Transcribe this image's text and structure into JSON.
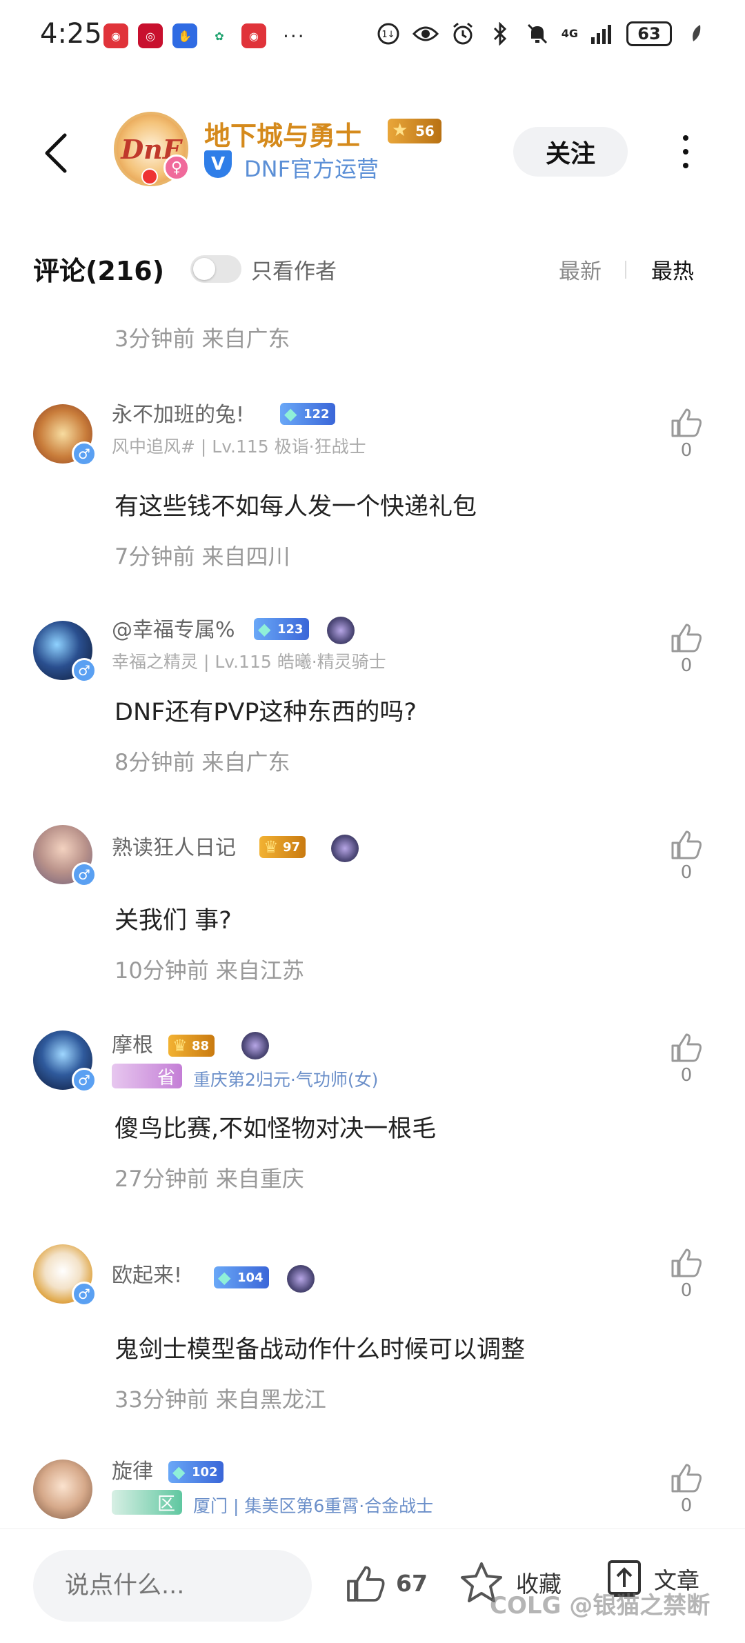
{
  "status_bar": {
    "time": "4:25",
    "network": "4G",
    "battery": "63",
    "dots": "···"
  },
  "header": {
    "channel_name": "地下城与勇士",
    "level": "56",
    "verified_mark": "V",
    "subtitle": "DNF官方运营",
    "follow_label": "关注",
    "avatar_logo": "DnF"
  },
  "comments_header": {
    "title": "评论(216)",
    "author_only_label": "只看作者",
    "sort_newest": "最新",
    "sort_hottest": "最热"
  },
  "top_meta": "3分钟前   来自广东",
  "comments": [
    {
      "name": "永不加班的兔!",
      "badge": "122",
      "sub": "风中追风# | Lv.115 极诣·狂战士",
      "text": "有这些钱不如每人发一个快递礼包",
      "meta": "7分钟前   来自四川",
      "likes": "0"
    },
    {
      "name": "@幸福专属%",
      "badge": "123",
      "sub": "幸福之精灵 | Lv.115 皓曦·精灵骑士",
      "text": "DNF还有PVP这种东西的吗?",
      "meta": "8分钟前   来自广东",
      "likes": "0"
    },
    {
      "name": "熟读狂人日记",
      "badge": "97",
      "sub": "",
      "text": "关我们  事?",
      "meta": "10分钟前   来自江苏",
      "likes": "0"
    },
    {
      "name": "摩根",
      "badge": "88",
      "province": "省",
      "sub": "重庆第2归元·气功师(女)",
      "text": "傻鸟比赛,不如怪物对决一根毛",
      "meta": "27分钟前   来自重庆",
      "likes": "0"
    },
    {
      "name": "欧起来!",
      "badge": "104",
      "sub": "",
      "text": "鬼剑士模型备战动作什么时候可以调整",
      "meta": "33分钟前   来自黑龙江",
      "likes": "0"
    },
    {
      "name": "旋律",
      "badge": "102",
      "province": "区",
      "sub": "厦门 | 集美区第6重霄·合金战士",
      "likes": "0"
    }
  ],
  "bottom_bar": {
    "input_placeholder": "说点什么...",
    "like_count": "67",
    "favorite_label": "收藏",
    "article_label": "文章"
  },
  "watermark": "COLG @银猫之禁断",
  "colors": {
    "channel_name": "#d58a1c",
    "subtitle": "#5b8fd6",
    "male_badge": "#5aa0f2",
    "female_badge": "#f06a9b"
  }
}
